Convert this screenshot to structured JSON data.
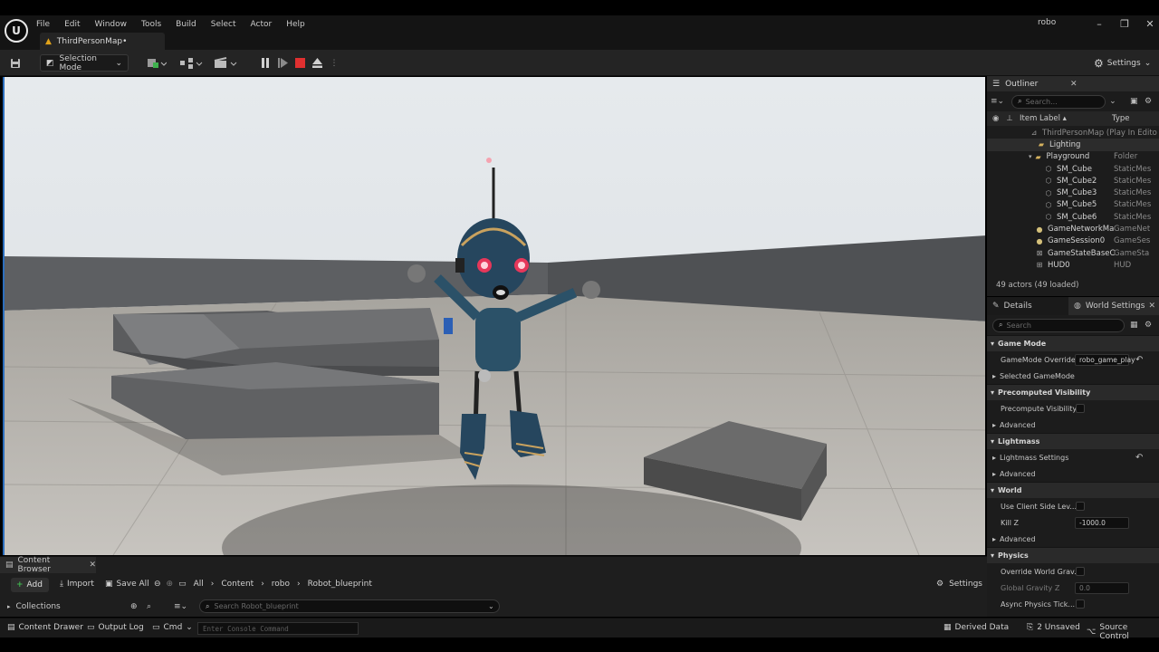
{
  "menu": [
    "File",
    "Edit",
    "Window",
    "Tools",
    "Build",
    "Select",
    "Actor",
    "Help"
  ],
  "project_name": "robo",
  "document_tab": "ThirdPersonMap•",
  "toolbar": {
    "selection_mode": "Selection Mode",
    "settings": "Settings"
  },
  "outliner": {
    "title": "Outliner",
    "search_placeholder": "Search...",
    "col_label": "Item Label ▴",
    "col_type": "Type",
    "items": [
      {
        "label": "ThirdPersonMap (Play In Edito",
        "type": "",
        "indent": 0
      },
      {
        "label": "Lighting",
        "type": "",
        "indent": 1
      },
      {
        "label": "Playground",
        "type": "Folder",
        "indent": 1
      },
      {
        "label": "SM_Cube",
        "type": "StaticMes",
        "indent": 2
      },
      {
        "label": "SM_Cube2",
        "type": "StaticMes",
        "indent": 2
      },
      {
        "label": "SM_Cube3",
        "type": "StaticMes",
        "indent": 2
      },
      {
        "label": "SM_Cube5",
        "type": "StaticMes",
        "indent": 2
      },
      {
        "label": "SM_Cube6",
        "type": "StaticMes",
        "indent": 2
      },
      {
        "label": "GameNetworkMa",
        "type": "GameNet",
        "indent": 1
      },
      {
        "label": "GameSession0",
        "type": "GameSes",
        "indent": 1
      },
      {
        "label": "GameStateBaseC",
        "type": "GameSta",
        "indent": 1
      },
      {
        "label": "HUD0",
        "type": "HUD",
        "indent": 1
      }
    ],
    "footer": "49 actors (49 loaded)"
  },
  "details": {
    "tab_details": "Details",
    "tab_world": "World Settings",
    "search_placeholder": "Search",
    "sections": {
      "game_mode": "Game Mode",
      "gamemode_override": "GameMode Override",
      "gamemode_override_value": "robo_game_play",
      "selected_gamemode": "Selected GameMode",
      "precomputed_visibility": "Precomputed Visibility",
      "precompute_visibility": "Precompute Visibility",
      "advanced": "Advanced",
      "lightmass": "Lightmass",
      "lightmass_settings": "Lightmass Settings",
      "world": "World",
      "use_client_side": "Use Client Side Lev...",
      "kill_z": "Kill Z",
      "kill_z_value": "-1000.0",
      "physics": "Physics",
      "override_gravity": "Override World Grav...",
      "global_gravity_z": "Global Gravity Z",
      "global_gravity_value": "0.0",
      "async_physics": "Async Physics Tick..."
    }
  },
  "content_browser": {
    "tab": "Content Browser",
    "add": "Add",
    "import": "Import",
    "save_all": "Save All",
    "breadcrumb": [
      "All",
      "Content",
      "robo",
      "Robot_blueprint"
    ],
    "settings": "Settings",
    "collections": "Collections",
    "search_placeholder": "Search Robot_blueprint"
  },
  "statusbar": {
    "content_drawer": "Content Drawer",
    "output_log": "Output Log",
    "cmd": "Cmd",
    "console_placeholder": "Enter Console Command",
    "derived_data": "Derived Data",
    "unsaved": "2 Unsaved",
    "source_control": "Source Control"
  }
}
